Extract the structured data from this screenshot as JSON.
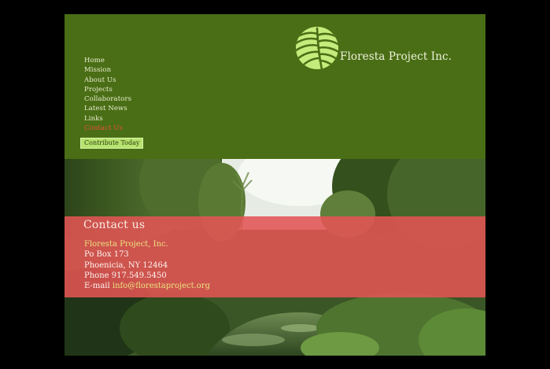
{
  "brand": {
    "name": "Floresta Project Inc.",
    "logo_icon": "leaf-icon",
    "logo_color": "#c4ec7c"
  },
  "nav": {
    "items": [
      {
        "label": "Home"
      },
      {
        "label": "Mission"
      },
      {
        "label": "About Us"
      },
      {
        "label": "Projects"
      },
      {
        "label": "Collaborators"
      },
      {
        "label": "Latest News"
      },
      {
        "label": "Links"
      },
      {
        "label": "Contact Us",
        "active": true
      }
    ],
    "contribute_label": "Contribute Today"
  },
  "contact": {
    "title": "Contact us",
    "org": "Floresta Project, Inc.",
    "po_box": "Po Box 173",
    "city": "Phoenicia, NY 12464",
    "phone": "Phone 917.549.5450",
    "email_prefix": "E-mail",
    "email": "info@florestaproject.org"
  },
  "colors": {
    "page_bg": "#000000",
    "header_bg": "#4a6e15",
    "nav_text": "#e9edd0",
    "nav_active": "#e8503c",
    "contribute_bg": "#b6e36e",
    "contact_band": "#e25454",
    "contact_highlight": "#ece27e"
  }
}
